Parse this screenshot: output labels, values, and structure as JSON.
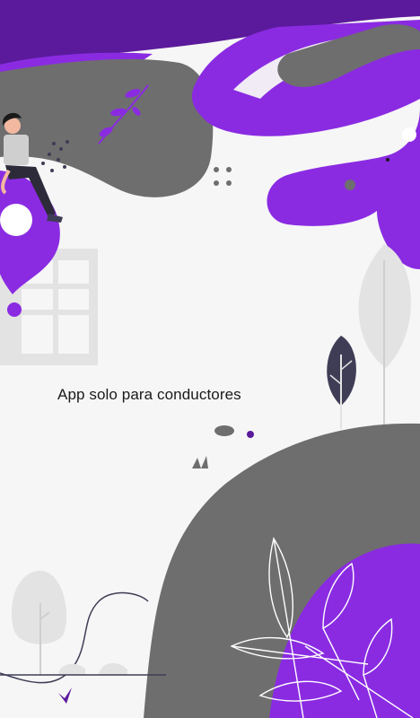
{
  "screen": {
    "caption": "App solo para conductores"
  },
  "colors": {
    "purple": "#8a2be2",
    "dark_purple": "#5b1a9c",
    "gray": "#6e6e6e",
    "light_gray": "#e3e3e3",
    "background": "#f6f6f6",
    "navy": "#3f3d56"
  }
}
